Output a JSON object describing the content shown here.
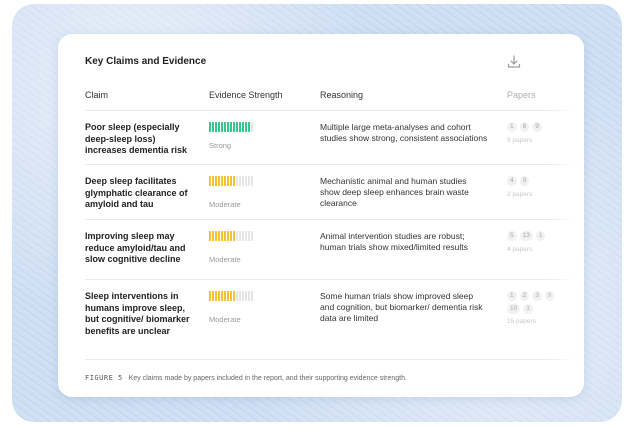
{
  "card": {
    "title": "Key Claims and Evidence",
    "download_icon": "download-icon"
  },
  "columns": [
    "Claim",
    "Evidence Strength",
    "Reasoning",
    "Papers"
  ],
  "rows": [
    {
      "claim": "Poor sleep (especially deep-sleep loss) increases dementia risk",
      "strength_label": "Strong",
      "strength_level": 0.9,
      "strength_color": "#36c58a",
      "reasoning": "Multiple large meta-analyses and cohort studies show strong, consistent associations",
      "papers": [
        "1",
        "8",
        "9"
      ],
      "papers_count": "5 papers"
    },
    {
      "claim": "Deep sleep facilitates glymphatic clearance of amyloid and tau",
      "strength_label": "Moderate",
      "strength_level": 0.6,
      "strength_color": "#f2c230",
      "reasoning": "Mechanistic animal and human studies show deep sleep enhances brain waste clearance",
      "papers": [
        "4",
        "9"
      ],
      "papers_count": "2 papers"
    },
    {
      "claim": "Improving sleep may reduce amyloid/tau and slow cognitive decline",
      "strength_label": "Moderate",
      "strength_level": 0.6,
      "strength_color": "#f2c230",
      "reasoning": "Animal intervention studies are robust; human trials show mixed/limited results",
      "papers": [
        "5",
        "13",
        "1"
      ],
      "papers_count": "4 papers"
    },
    {
      "claim": "Sleep interventions in humans improve sleep, but cognitive/ biomarker benefits are unclear",
      "strength_label": "Moderate",
      "strength_level": 0.6,
      "strength_color": "#f2c230",
      "reasoning": "Some human trials show improved sleep and cognition, but biomarker/ dementia risk data are limited",
      "papers": [
        "1",
        "2",
        "3",
        "9",
        "10",
        "1"
      ],
      "papers_count": "15 papers"
    }
  ],
  "caption": {
    "figure": "FIGURE 5",
    "text": "Key claims made by papers included in the report, and their supporting evidence strength."
  }
}
